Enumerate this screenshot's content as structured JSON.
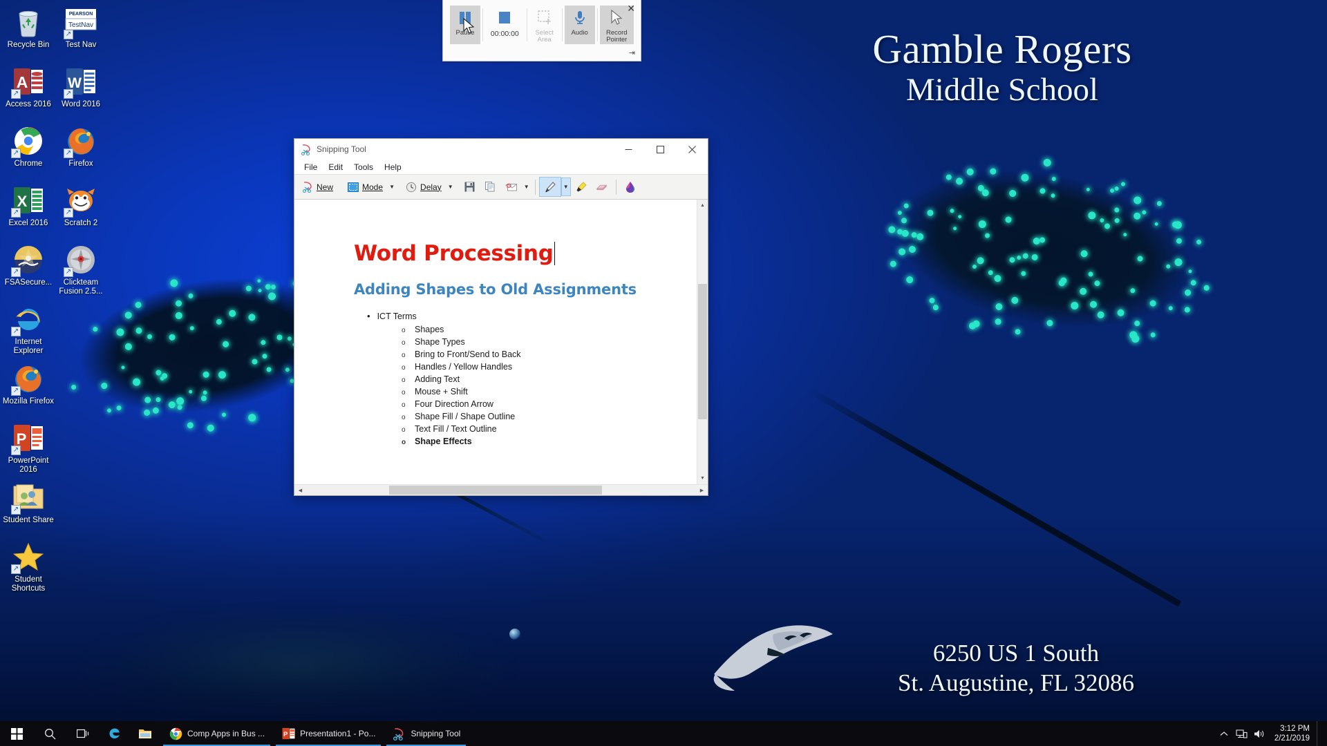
{
  "desktop": {
    "wallpaper": {
      "school_name_line1": "Gamble Rogers",
      "school_name_line2": "Middle School",
      "address_line1": "6250 US 1 South",
      "address_line2": "St. Augustine, FL 32086",
      "bg_color": "#0a2f9e"
    },
    "icons_col1": [
      {
        "label": "Recycle Bin",
        "icon": "recycle-bin-icon",
        "shortcut": false
      },
      {
        "label": "Access 2016",
        "icon": "access-icon",
        "shortcut": true
      },
      {
        "label": "Chrome",
        "icon": "chrome-icon",
        "shortcut": true
      },
      {
        "label": "Excel 2016",
        "icon": "excel-icon",
        "shortcut": true
      },
      {
        "label": "FSASecure...",
        "icon": "fsa-secure-icon",
        "shortcut": true
      },
      {
        "label": "Internet Explorer",
        "icon": "internet-explorer-icon",
        "shortcut": true
      },
      {
        "label": "Mozilla Firefox",
        "icon": "firefox-icon",
        "shortcut": true
      },
      {
        "label": "PowerPoint 2016",
        "icon": "powerpoint-icon",
        "shortcut": true
      },
      {
        "label": "Student Share",
        "icon": "shared-folder-icon",
        "shortcut": true
      },
      {
        "label": "Student Shortcuts",
        "icon": "star-folder-icon",
        "shortcut": true
      }
    ],
    "icons_col2": [
      {
        "label": "Test Nav",
        "icon": "testnav-icon",
        "shortcut": true,
        "brand": "PEARSON",
        "brand_sub": "TestNav"
      },
      {
        "label": "Word 2016",
        "icon": "word-icon",
        "shortcut": true
      },
      {
        "label": "Firefox",
        "icon": "firefox-icon",
        "shortcut": true
      },
      {
        "label": "Scratch 2",
        "icon": "scratch-icon",
        "shortcut": true
      },
      {
        "label": "Clickteam Fusion 2.5...",
        "icon": "clickteam-fusion-icon",
        "shortcut": true
      }
    ]
  },
  "recorder": {
    "buttons": [
      {
        "label": "Pause",
        "icon": "pause-icon",
        "state": "active"
      },
      {
        "label": "00:00:00",
        "icon": "stop-icon",
        "state": "normal"
      },
      {
        "label": "Select Area",
        "icon": "select-area-icon",
        "state": "disabled"
      },
      {
        "label": "Audio",
        "icon": "microphone-icon",
        "state": "active"
      },
      {
        "label": "Record Pointer",
        "icon": "record-pointer-icon",
        "state": "active"
      }
    ],
    "timer": "00:00:00",
    "close_label": "✕",
    "pin_label": "⇥"
  },
  "snipping_tool": {
    "title": "Snipping Tool",
    "window_controls": {
      "minimize": "—",
      "maximize": "☐",
      "close": "✕"
    },
    "menus": [
      "File",
      "Edit",
      "Tools",
      "Help"
    ],
    "toolbar": {
      "new_label": "New",
      "mode_label": "Mode",
      "delay_label": "Delay",
      "save_title": "Save Snip",
      "copy_title": "Copy",
      "email_title": "Send Snip",
      "pen_title": "Pen",
      "highlighter_title": "Highlighter",
      "eraser_title": "Eraser",
      "ink_title": "Ink"
    },
    "document": {
      "title": "Word Processing",
      "title_color": "#e01b10",
      "subtitle": "Adding Shapes to Old Assignments",
      "subtitle_color": "#3d85bf",
      "list_heading": "ICT Terms",
      "list_items": [
        {
          "text": "Shapes",
          "bold": false
        },
        {
          "text": "Shape Types",
          "bold": false
        },
        {
          "text": "Bring to Front/Send to Back",
          "bold": false
        },
        {
          "text": "Handles / Yellow Handles",
          "bold": false
        },
        {
          "text": "Adding Text",
          "bold": false
        },
        {
          "text": "Mouse + Shift",
          "bold": false
        },
        {
          "text": "Four Direction Arrow",
          "bold": false
        },
        {
          "text": "Shape Fill / Shape Outline",
          "bold": false
        },
        {
          "text": "Text Fill / Text Outline",
          "bold": false
        },
        {
          "text": "Shape Effects",
          "bold": true
        }
      ]
    }
  },
  "taskbar": {
    "start_title": "Start",
    "search_title": "Search",
    "taskview_title": "Task View",
    "pinned": [
      {
        "label": "Microsoft Edge",
        "icon": "edge-icon"
      },
      {
        "label": "File Explorer",
        "icon": "file-explorer-icon"
      }
    ],
    "apps": [
      {
        "label": "Comp Apps in Bus ...",
        "icon": "chrome-icon",
        "running": true
      },
      {
        "label": "Presentation1 - Po...",
        "icon": "powerpoint-icon",
        "running": true
      },
      {
        "label": "Snipping Tool",
        "icon": "snipping-tool-icon",
        "running": true
      }
    ],
    "tray": {
      "chevron": "⌃",
      "network_title": "Network",
      "volume_title": "Volume",
      "time": "3:12 PM",
      "date": "2/21/2019"
    }
  }
}
